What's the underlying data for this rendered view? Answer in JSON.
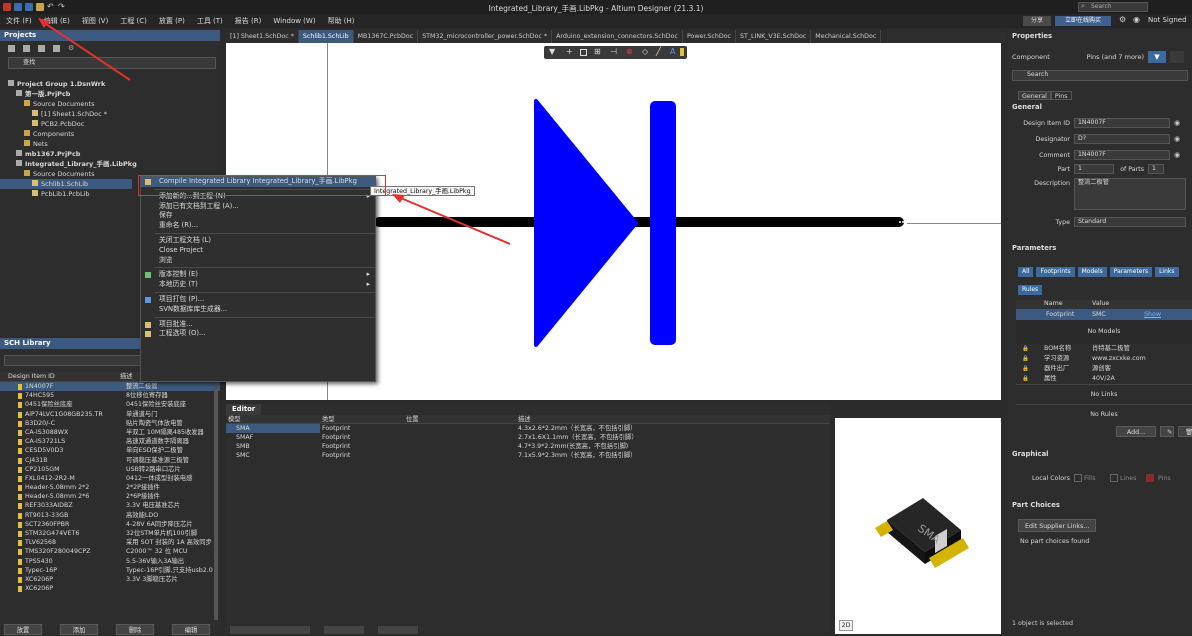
{
  "window": {
    "title": "Integrated_Library_手画.LibPkg - Altium Designer (21.3.1)"
  },
  "menu": [
    "文件 (F)",
    "编辑 (E)",
    "视图 (V)",
    "工程 (C)",
    "放置 (P)",
    "工具 (T)",
    "报告 (R)",
    "Window (W)",
    "帮助 (H)"
  ],
  "topright": {
    "search": "Search",
    "share": "分享",
    "login": "立即在线购买",
    "user": "Not Signed"
  },
  "projects": {
    "title": "Projects",
    "search": "查找",
    "tree": [
      {
        "label": "Project Group 1.DsnWrk",
        "indent": 0,
        "bold": true
      },
      {
        "label": "第一版.PrjPcb",
        "indent": 1,
        "bold": true
      },
      {
        "label": "Source Documents",
        "indent": 2,
        "bold": false
      },
      {
        "label": "[1] Sheet1.SchDoc *",
        "indent": 3,
        "bold": false
      },
      {
        "label": "PCB2.PcbDoc",
        "indent": 3,
        "bold": false
      },
      {
        "label": "Components",
        "indent": 2,
        "bold": false
      },
      {
        "label": "Nets",
        "indent": 2,
        "bold": false
      },
      {
        "label": "mb1367.PrjPcb",
        "indent": 1,
        "bold": true
      },
      {
        "label": "Integrated_Library_手画.LibPkg",
        "indent": 1,
        "bold": true
      },
      {
        "label": "Source Documents",
        "indent": 2,
        "bold": false
      },
      {
        "label": "Schlib1.SchLib",
        "indent": 3,
        "bold": false
      },
      {
        "label": "PcbLib1.PcbLib",
        "indent": 3,
        "bold": false
      }
    ]
  },
  "schlib": {
    "title": "SCH Library",
    "col1": "Design Item ID",
    "col2": "描述",
    "rows": [
      [
        "1N4007F",
        "整流二极管"
      ],
      [
        "74HC595",
        "8位移位寄存器"
      ],
      [
        "0451保险丝底座",
        "0451保险丝安装底座"
      ],
      [
        "AiP74LVC1G08GB235.TR",
        "单通道与门"
      ],
      [
        "B3D20/-C",
        "贴片陶瓷气体放电管"
      ],
      [
        "CA-IS3088WX",
        "半双工 10M隔离485收发器"
      ],
      [
        "CA-IS3721LS",
        "高速双通道数字隔离器"
      ],
      [
        "CESD5V0D3",
        "单向ESD保护二极管"
      ],
      [
        "CJ431B",
        "可调稳压基准源三极管"
      ],
      [
        "CP2105GM",
        "USB转2路串口芯片"
      ],
      [
        "FXL0412-2R2-M",
        "0412一体成型封装电感"
      ],
      [
        "Header-5.08mm 2*2",
        "2*2P接插件"
      ],
      [
        "Header-5.08mm 2*6",
        "2*6P接插件"
      ],
      [
        "REF3033AIDBZ",
        "3.3V 电压基准芯片"
      ],
      [
        "RT9013-33GB",
        "高效能LDO"
      ],
      [
        "SCT2360FPBR",
        "4-28V 6A同步降压芯片"
      ],
      [
        "STM32G474VET6",
        "32位STM单片机100引脚"
      ],
      [
        "TLV62568",
        "采用 SOT 封装的 1A 高效同步"
      ],
      [
        "TMS320F280049CPZ",
        "C2000™ 32 位 MCU"
      ],
      [
        "TPS5430",
        "5.5-36V输入3A输出"
      ],
      [
        "Typec-16P",
        "Typec-16P引脚,只支持usb2.0"
      ],
      [
        "XC6206P",
        "3.3V 3脚稳压芯片"
      ],
      [
        "XC6206P",
        ""
      ]
    ],
    "buttons": [
      "放置",
      "添加",
      "删除",
      "编辑"
    ]
  },
  "tabs": [
    {
      "label": "[1] Sheet1.SchDoc *",
      "active": false
    },
    {
      "label": "Schlib1.SchLib",
      "active": true
    },
    {
      "label": "MB1367C.PcbDoc",
      "active": false
    },
    {
      "label": "STM32_microcontroller_power.SchDoc *",
      "active": false
    },
    {
      "label": "Arduino_extension_connectors.SchDoc",
      "active": false
    },
    {
      "label": "Power.SchDoc",
      "active": false
    },
    {
      "label": "ST_LINK_V3E.SchDoc",
      "active": false
    },
    {
      "label": "Mechanical.SchDoc",
      "active": false
    }
  ],
  "contextMenu": {
    "tooltip": "Integrated_Library_手画.LibPkg",
    "items": [
      {
        "label": "Compile Integrated Library Integrated_Library_手画.LibPkg",
        "sub": false,
        "sep_before": false,
        "hl": true
      },
      {
        "label": "添加新的...到工程 (N)",
        "sub": true,
        "sep_before": true,
        "hl": false
      },
      {
        "label": "添加已有文档到工程 (A)...",
        "sub": false,
        "sep_before": false,
        "hl": false
      },
      {
        "label": "保存",
        "sub": false,
        "sep_before": false,
        "hl": false
      },
      {
        "label": "重命名 (R)...",
        "sub": false,
        "sep_before": false,
        "hl": false
      },
      {
        "label": "关闭工程文档 (L)",
        "sub": false,
        "sep_before": true,
        "hl": false
      },
      {
        "label": "Close Project",
        "sub": false,
        "sep_before": false,
        "hl": false
      },
      {
        "label": "浏览",
        "sub": false,
        "sep_before": false,
        "hl": false
      },
      {
        "label": "版本控制 (E)",
        "sub": true,
        "sep_before": true,
        "hl": false
      },
      {
        "label": "本地历史 (T)",
        "sub": true,
        "sep_before": false,
        "hl": false
      },
      {
        "label": "项目打包 (P)...",
        "sub": false,
        "sep_before": true,
        "hl": false
      },
      {
        "label": "SVN数据库库生成器...",
        "sub": false,
        "sep_before": false,
        "hl": false
      },
      {
        "label": "项目批准...",
        "sub": false,
        "sep_before": true,
        "hl": false
      },
      {
        "label": "工程选项 (O)...",
        "sub": false,
        "sep_before": false,
        "hl": false
      }
    ]
  },
  "editor": {
    "title": "Editor",
    "headers": [
      "模型",
      "类型",
      "位置",
      "描述"
    ],
    "rows": [
      [
        "SMA",
        "Footprint",
        "",
        "4.3x2.6*2.2mm（长宽高，不包括引脚）"
      ],
      [
        "SMAF",
        "Footprint",
        "",
        "2.7x1.6X1.1mm（长宽高，不包括引脚）"
      ],
      [
        "SMB",
        "Footprint",
        "",
        "4.7*3.9*2.2mm(长宽高，不包括引脚)"
      ],
      [
        "SMC",
        "Footprint",
        "",
        "7.1x5.9*2.3mm（长宽高，不包括引脚）"
      ]
    ],
    "view2d": "2D",
    "package_text": "SMA"
  },
  "properties": {
    "title": "Properties",
    "component": "Component",
    "filter": "Pins (and 7 more)",
    "search": "Search",
    "subtabs": [
      "General",
      "Pins"
    ],
    "general_title": "General",
    "fields": [
      {
        "label": "Design Item ID",
        "value": "1N4007F"
      },
      {
        "label": "Designator",
        "value": "D?"
      },
      {
        "label": "Comment",
        "value": "1N4007F"
      }
    ],
    "part_label": "Part",
    "part_of": "of Parts",
    "part_value": "1",
    "parts_total": "1",
    "description_label": "Description",
    "description": "整流二极管",
    "type_label": "Type",
    "type": "Standard",
    "parameters_title": "Parameters",
    "param_chips": [
      "All",
      "Footprints",
      "Models",
      "Parameters",
      "Links",
      "Rules"
    ],
    "param_cols": [
      "Name",
      "Value"
    ],
    "footprint_row": {
      "name": "Footprint",
      "value": "SMC",
      "show": "Show"
    },
    "no_models": "No Models",
    "param_rows": [
      {
        "name": "BOM名称",
        "value": "肖特基二极管"
      },
      {
        "name": "学习资源",
        "value": "www.zxcxke.com"
      },
      {
        "name": "器件出厂",
        "value": "源创客"
      },
      {
        "name": "属性",
        "value": "40V/2A"
      }
    ],
    "no_links": "No Links",
    "no_rules": "No Rules",
    "add_btn": "Add...",
    "graphical_title": "Graphical",
    "local_colors": "Local Colors",
    "fills": "Fills",
    "lines": "Lines",
    "pins": "Pins",
    "part_choices_title": "Part Choices",
    "edit_supplier": "Edit Supplier Links...",
    "no_part_choices": "No part choices found",
    "status": "1 object is selected"
  }
}
